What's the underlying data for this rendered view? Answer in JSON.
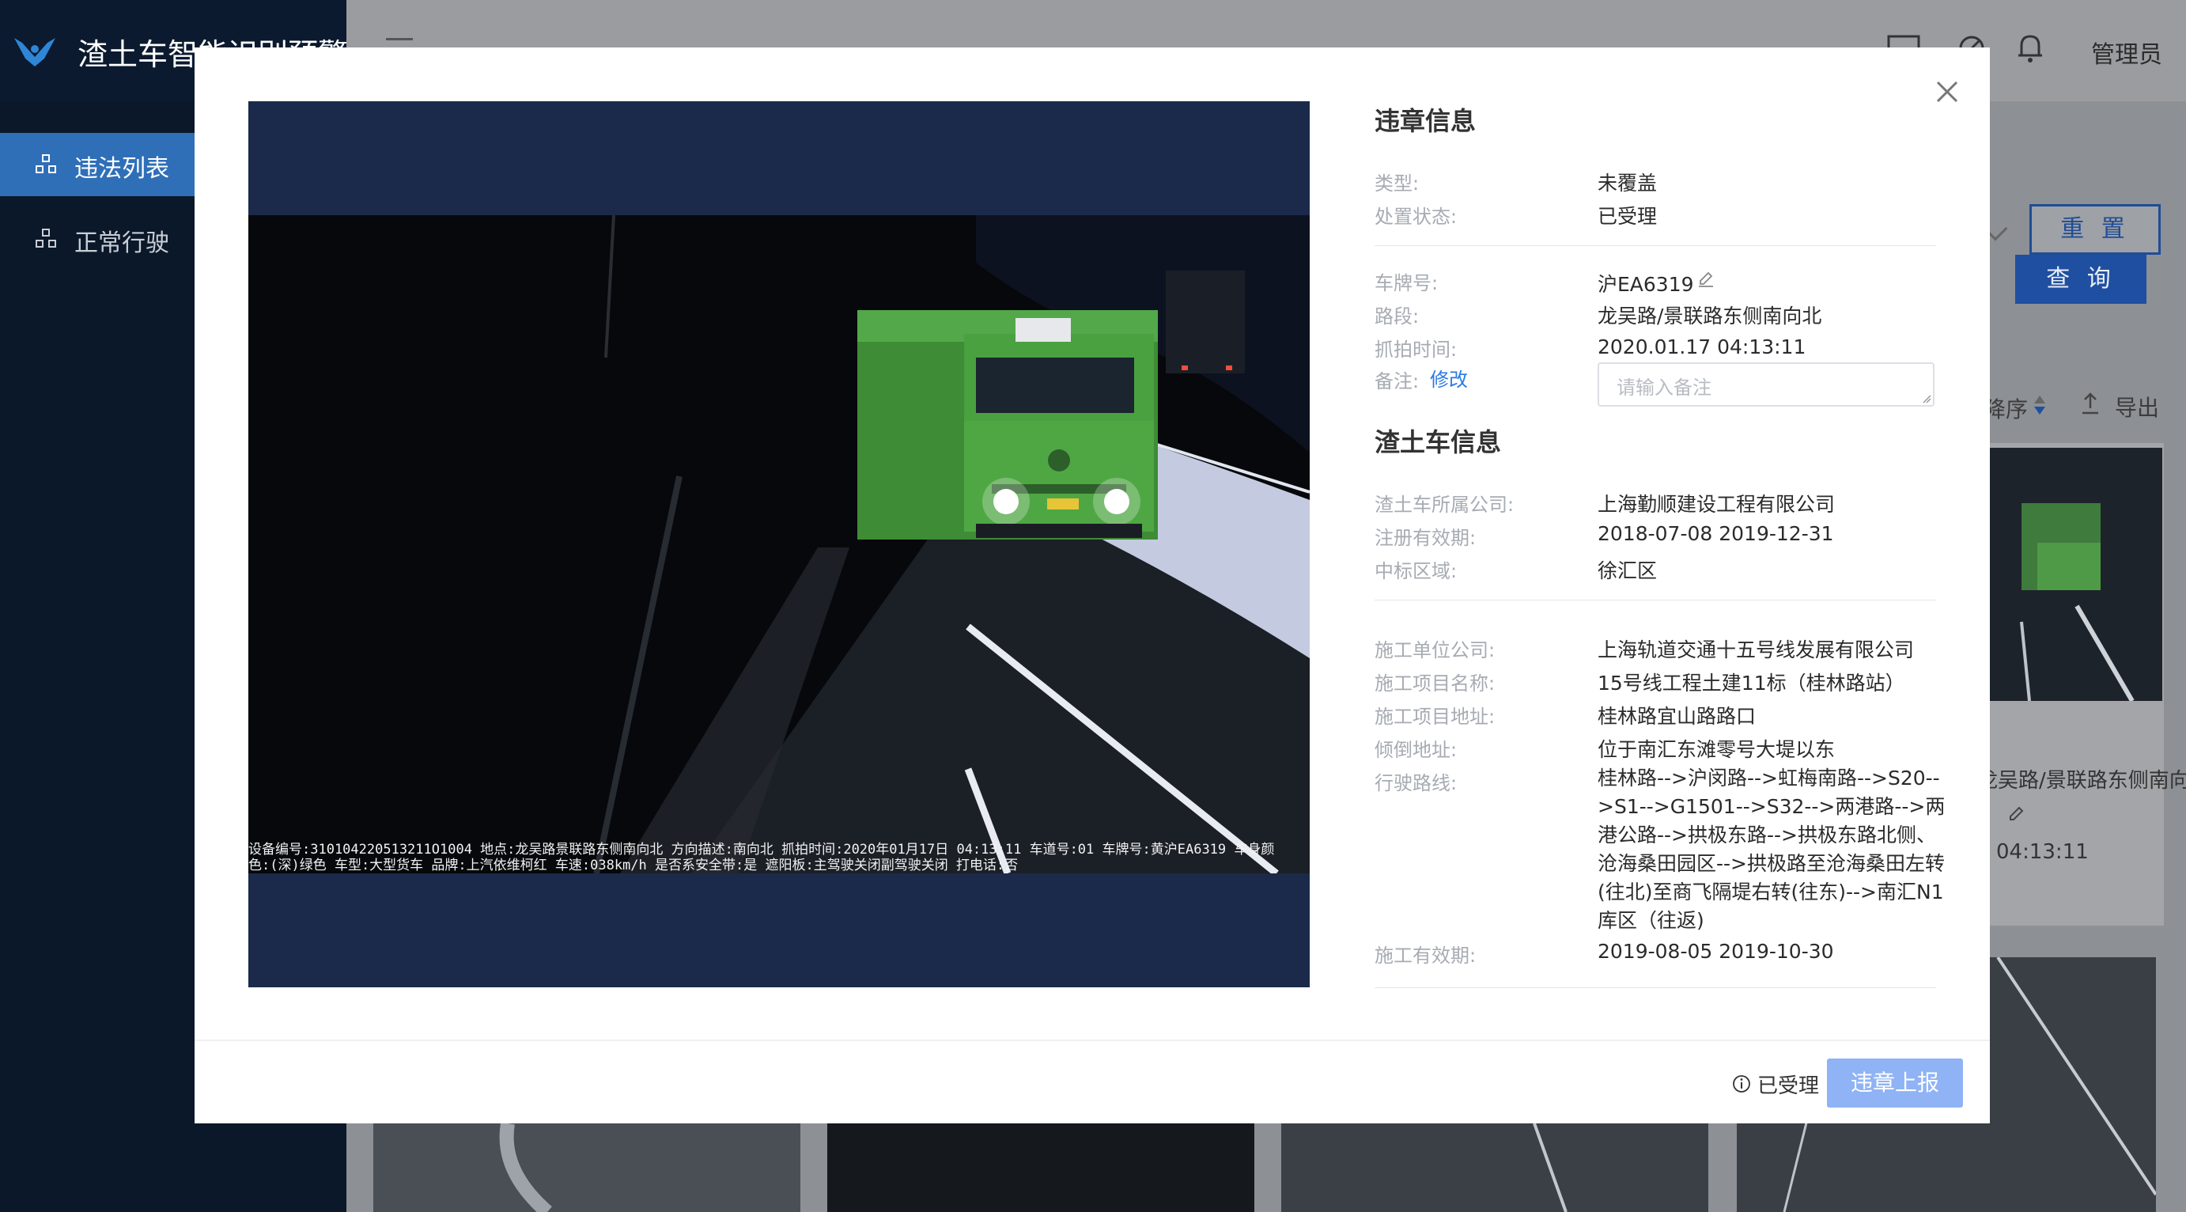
{
  "app": {
    "title": "渣土车智能识别预警",
    "admin": "管理员"
  },
  "sidebar": {
    "items": [
      {
        "label": "违法列表",
        "active": true
      },
      {
        "label": "正常行驶",
        "active": false
      }
    ]
  },
  "toolbar": {
    "reset_label": "重 置",
    "search_label": "查 询",
    "sort_label": "降序",
    "export_label": "导出"
  },
  "background_card": {
    "location_partial": "龙吴路/景联路东侧南向北",
    "time_partial": "04:13:11"
  },
  "modal": {
    "photo_caption_line1": "设备编号:310104220513211O1004 地点:龙吴路景联路东侧南向北 方向描述:南向北 抓拍时间:2020年01月17日 04:13:11 车道号:01 车牌号:黄沪EA6319 车身颜",
    "photo_caption_line2": "色:(深)绿色 车型:大型货车 品牌:上汽依维柯红 车速:038km/h 是否系安全带:是 遮阳板:主驾驶关闭副驾驶关闭 打电话:否",
    "violation_section": {
      "title": "违章信息",
      "type_label": "类型:",
      "type_value": "未覆盖",
      "status_label": "处置状态:",
      "status_value": "已受理",
      "plate_label": "车牌号:",
      "plate_value": "沪EA6319",
      "road_label": "路段:",
      "road_value": "龙吴路/景联路东侧南向北",
      "time_label": "抓拍时间:",
      "time_value": "2020.01.17 04:13:11",
      "remark_label": "备注:",
      "remark_edit": "修改",
      "remark_placeholder": "请输入备注"
    },
    "truck_section": {
      "title": "渣土车信息",
      "company_label": "渣土车所属公司:",
      "company_value": "上海勤顺建设工程有限公司",
      "registration_label": "注册有效期:",
      "registration_value": "2018-07-08 2019-12-31",
      "bid_area_label": "中标区域:",
      "bid_area_value": "徐汇区",
      "construction_company_label": "施工单位公司:",
      "construction_company_value": "上海轨道交通十五号线发展有限公司",
      "project_name_label": "施工项目名称:",
      "project_name_value": "15号线工程土建11标（桂林路站）",
      "project_address_label": "施工项目地址:",
      "project_address_value": "桂林路宜山路路口",
      "dump_address_label": "倾倒地址:",
      "dump_address_value": "位于南汇东滩零号大堤以东",
      "route_label": "行驶路线:",
      "route_value": "桂林路-->沪闵路-->虹梅南路-->S20-->S1-->G1501-->S32-->两港路-->两港公路-->拱极东路-->拱极东路北侧、沧海桑田园区-->拱极路至沧海桑田左转(往北)至商飞隔堤右转(往东)-->南汇N1库区（往返)",
      "validity_label": "施工有效期:",
      "validity_value": "2019-08-05 2019-10-30"
    },
    "footer": {
      "status_text": "已受理",
      "report_button": "违章上报"
    }
  },
  "colors": {
    "sidebar_bg": "#0b1829",
    "nav_active": "#2f6fb8",
    "accent_blue": "#1f4fa0",
    "link_blue": "#2a7ae2",
    "report_button_bg": "#8fb3f4",
    "photo_frame": "#1b2a4a"
  }
}
